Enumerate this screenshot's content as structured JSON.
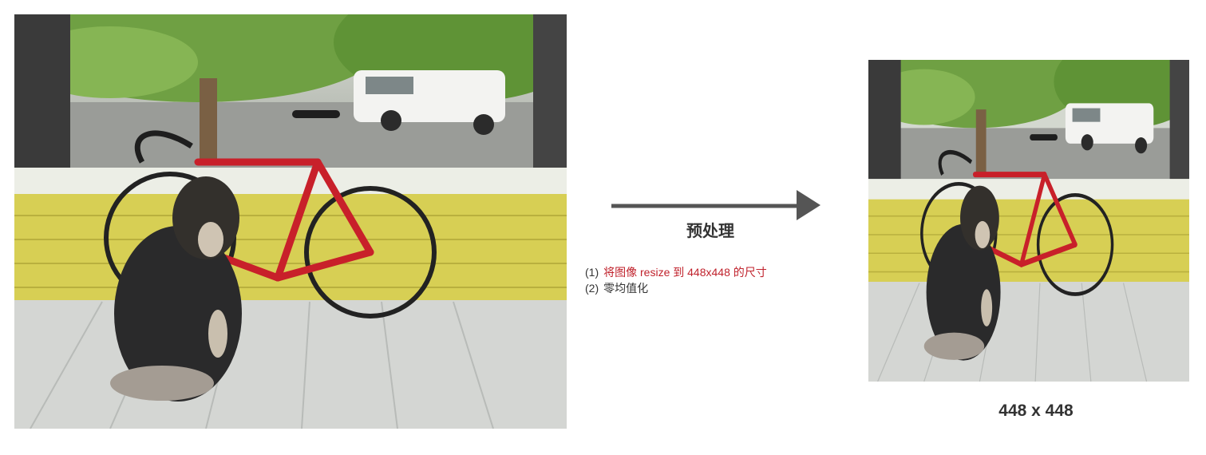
{
  "diagram": {
    "step_title": "预处理",
    "steps": [
      {
        "index": "(1)",
        "text": "将图像 resize 到 448x448 的尺寸"
      },
      {
        "index": "(2)",
        "text": "零均值化"
      }
    ],
    "output_size_label": "448 x 448"
  },
  "colors": {
    "arrow": "#555555",
    "text": "#333333",
    "step_highlight": "#c0222c"
  },
  "images": {
    "source": "dog-and-bicycle-photo",
    "output": "dog-and-bicycle-photo-resized"
  }
}
